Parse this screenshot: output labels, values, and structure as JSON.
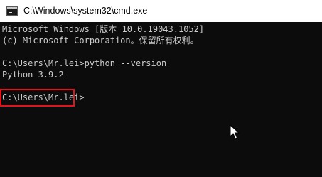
{
  "window": {
    "title": "C:\\Windows\\system32\\cmd.exe",
    "icon": "cmd-icon"
  },
  "console": {
    "lines": [
      "Microsoft Windows [版本 10.0.19043.1052]",
      "(c) Microsoft Corporation。保留所有权利。",
      "C:\\Users\\Mr.lei>python --version",
      "Python 3.9.2",
      "C:\\Users\\Mr.lei>"
    ]
  },
  "colors": {
    "console_background": "#0c0c0c",
    "console_text": "#cccccc",
    "highlight": "#e0141d"
  },
  "icons": {
    "mouse_cursor": "arrow-pointer-icon"
  }
}
